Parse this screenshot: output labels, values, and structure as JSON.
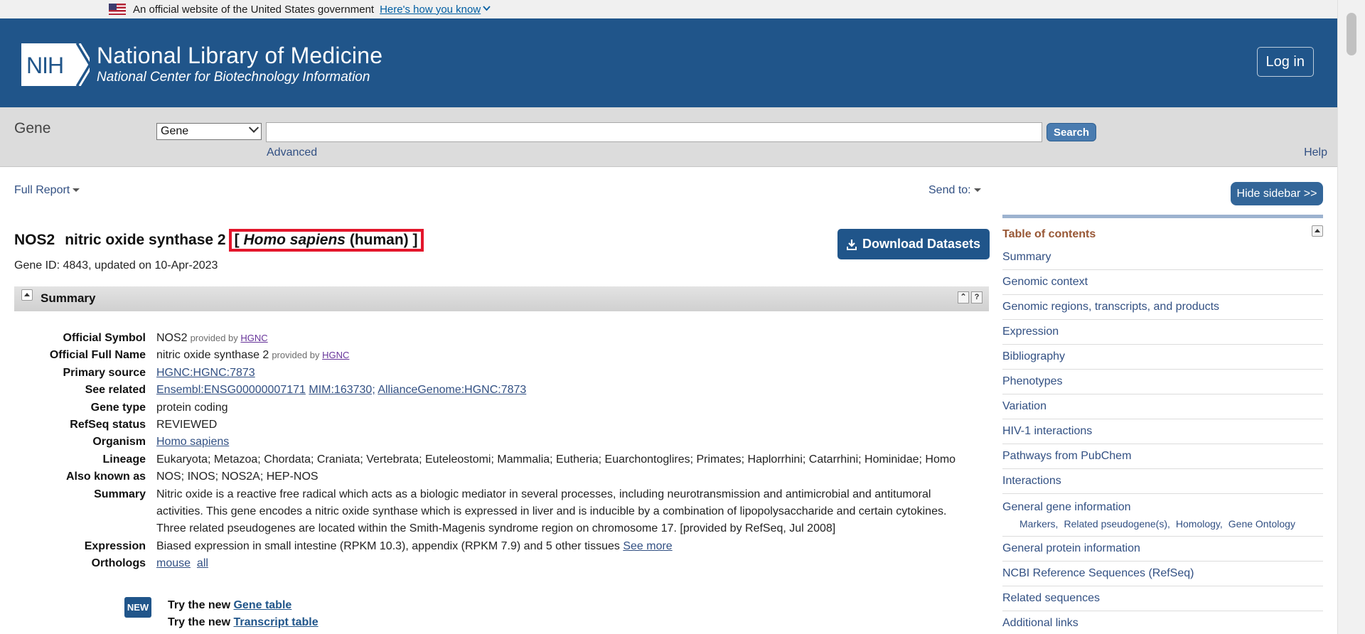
{
  "gov_banner": {
    "text": "An official website of the United States government",
    "link": "Here's how you know"
  },
  "header": {
    "logo_text": "NIH",
    "title": "National Library of Medicine",
    "subtitle": "National Center for Biotechnology Information",
    "login_label": "Log in"
  },
  "search": {
    "db_label": "Gene",
    "db_selected": "Gene",
    "query": "",
    "button_label": "Search",
    "advanced_label": "Advanced",
    "help_label": "Help"
  },
  "toolbar": {
    "full_report": "Full Report",
    "send_to": "Send to:",
    "hide_sidebar": "Hide sidebar >>"
  },
  "gene": {
    "symbol": "NOS2",
    "name": "nitric oxide synthase 2",
    "species_open": "[",
    "species_italic": "Homo sapiens",
    "species_common": "(human)",
    "species_close": "]",
    "meta": "Gene ID: 4843, updated on 10-Apr-2023",
    "download_label": "Download Datasets"
  },
  "summary": {
    "title": "Summary",
    "rows": {
      "official_symbol": {
        "label": "Official Symbol",
        "value": "NOS2",
        "provided_by": "provided by",
        "provider": "HGNC"
      },
      "official_full_name": {
        "label": "Official Full Name",
        "value": "nitric oxide synthase 2",
        "provided_by": "provided by",
        "provider": "HGNC"
      },
      "primary_source": {
        "label": "Primary source",
        "link": "HGNC:HGNC:7873"
      },
      "see_related": {
        "label": "See related",
        "links": [
          "Ensembl:ENSG00000007171",
          "MIM:163730;",
          "AllianceGenome:HGNC:7873"
        ]
      },
      "gene_type": {
        "label": "Gene type",
        "value": "protein coding"
      },
      "refseq_status": {
        "label": "RefSeq status",
        "value": "REVIEWED"
      },
      "organism": {
        "label": "Organism",
        "link": "Homo sapiens"
      },
      "lineage": {
        "label": "Lineage",
        "value": "Eukaryota; Metazoa; Chordata; Craniata; Vertebrata; Euteleostomi; Mammalia; Eutheria; Euarchontoglires; Primates; Haplorrhini; Catarrhini; Hominidae; Homo"
      },
      "also_known_as": {
        "label": "Also known as",
        "value": "NOS; INOS; NOS2A; HEP-NOS"
      },
      "summary_text": {
        "label": "Summary",
        "value": "Nitric oxide is a reactive free radical which acts as a biologic mediator in several processes, including neurotransmission and antimicrobial and antitumoral activities. This gene encodes a nitric oxide synthase which is expressed in liver and is inducible by a combination of lipopolysaccharide and certain cytokines. Three related pseudogenes are located within the Smith-Magenis syndrome region on chromosome 17. [provided by RefSeq, Jul 2008]"
      },
      "expression": {
        "label": "Expression",
        "value": "Biased expression in small intestine (RPKM 10.3), appendix (RPKM 7.9) and 5 other tissues",
        "link": "See more"
      },
      "orthologs": {
        "label": "Orthologs",
        "links": [
          "mouse",
          "all"
        ]
      }
    },
    "try_new": {
      "badge": "NEW",
      "prefix": "Try the new",
      "gene_table": "Gene table",
      "transcript_table": "Transcript table"
    }
  },
  "sidebar": {
    "toc_title": "Table of contents",
    "items": [
      "Summary",
      "Genomic context",
      "Genomic regions, transcripts, and products",
      "Expression",
      "Bibliography",
      "Phenotypes",
      "Variation",
      "HIV-1 interactions",
      "Pathways from PubChem",
      "Interactions",
      "General gene information",
      "General protein information",
      "NCBI Reference Sequences (RefSeq)",
      "Related sequences",
      "Additional links"
    ],
    "general_gene_sub": [
      "Markers,",
      "Related pseudogene(s),",
      "Homology,",
      "Gene Ontology"
    ]
  },
  "colors": {
    "header_blue": "#20558a",
    "link_blue": "#325083",
    "highlight_red": "#e3162b",
    "toc_title_brown": "#985735"
  },
  "icons": [
    "us-flag-icon",
    "chevron-down-icon",
    "nih-logo-icon",
    "download-icon",
    "collapse-icon",
    "scroll-to-top-icon",
    "help-icon"
  ]
}
